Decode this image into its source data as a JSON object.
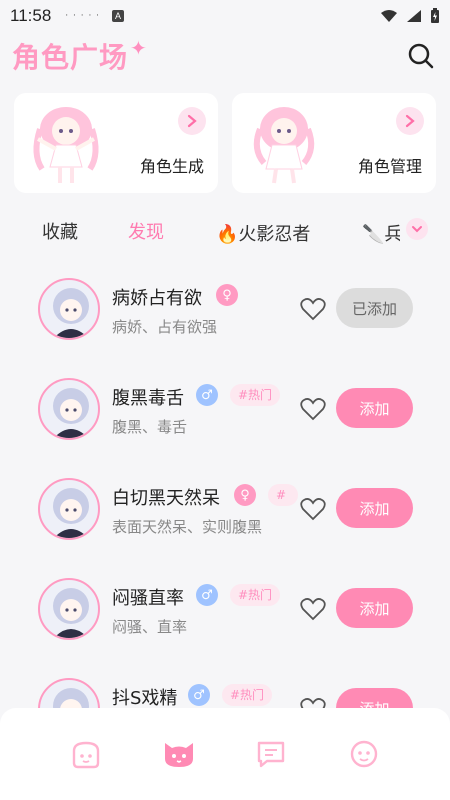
{
  "status_bar": {
    "time": "11:58",
    "dots": "· · · · ·",
    "a_icon": "A"
  },
  "header": {
    "brand": "角色广场",
    "brand_star": "✦"
  },
  "cards": [
    {
      "label": "角色生成"
    },
    {
      "label": "角色管理"
    }
  ],
  "tabs": [
    {
      "label": "收藏",
      "active": false
    },
    {
      "label": "发现",
      "active": true
    },
    {
      "label": "🔥火影忍者",
      "active": false
    },
    {
      "label": "🔪兵",
      "active": false
    }
  ],
  "characters": [
    {
      "name": "病娇占有欲",
      "gender": "female",
      "gender_symbol": "♀",
      "tag": "",
      "desc": "病娇、占有欲强",
      "button": "已添加",
      "added": true
    },
    {
      "name": "腹黑毒舌",
      "gender": "male",
      "gender_symbol": "♂",
      "tag": "#热门",
      "desc": "腹黑、毒舌",
      "button": "添加",
      "added": false
    },
    {
      "name": "白切黑天然呆",
      "gender": "female",
      "gender_symbol": "♀",
      "tag": "#",
      "desc": "表面天然呆、实则腹黑",
      "button": "添加",
      "added": false
    },
    {
      "name": "闷骚直率",
      "gender": "male",
      "gender_symbol": "♂",
      "tag": "#热门",
      "desc": "闷骚、直率",
      "button": "添加",
      "added": false
    },
    {
      "name": "抖S戏精",
      "gender": "male",
      "gender_symbol": "♂",
      "tag": "#热门",
      "desc": "",
      "button": "添加",
      "added": false
    }
  ],
  "colors": {
    "accent": "#ff8ab4",
    "brand": "#ff9ac2",
    "male": "#9fc3ff"
  },
  "bottom_nav": [
    {
      "icon": "face-icon"
    },
    {
      "icon": "cat-icon"
    },
    {
      "icon": "chat-icon"
    },
    {
      "icon": "profile-icon"
    }
  ]
}
